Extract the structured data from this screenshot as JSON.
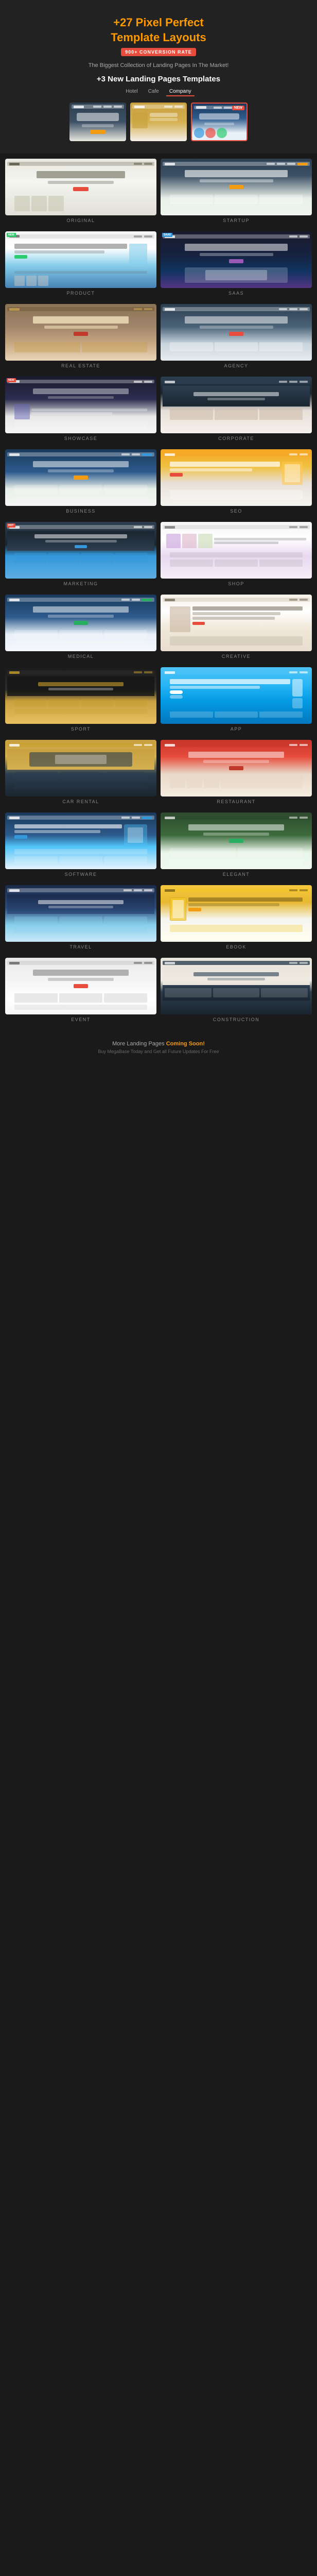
{
  "header": {
    "title_part1": "+27 Pixel Perfect",
    "title_part2": "Template Layouts",
    "badge": "900+ CONVERSION RATE",
    "subtitle": "The Biggest Collection of Landing Pages In The Market!",
    "new_templates_title": "+3 New Landing Pages Templates",
    "tabs": [
      "Hotel",
      "Cafe",
      "Company"
    ],
    "active_tab": "Company"
  },
  "templates": [
    {
      "id": "original",
      "label": "ORIGINAL",
      "style": "tpl-original",
      "tag": null
    },
    {
      "id": "startup",
      "label": "STARTUP",
      "style": "tpl-startup",
      "tag": null
    },
    {
      "id": "product",
      "label": "PRODUCT",
      "style": "tpl-product",
      "tag": "PRODUCT"
    },
    {
      "id": "saas",
      "label": "SAAS",
      "style": "tpl-saas",
      "tag": "SAAS"
    },
    {
      "id": "realestate",
      "label": "REAL ESTATE",
      "style": "tpl-realestate",
      "tag": null
    },
    {
      "id": "agency",
      "label": "AGENCY",
      "style": "tpl-agency",
      "tag": null
    },
    {
      "id": "showcase",
      "label": "SHOWCASE",
      "style": "tpl-showcase",
      "tag": null
    },
    {
      "id": "corporate",
      "label": "CORPORATE",
      "style": "tpl-corporate",
      "tag": null
    },
    {
      "id": "business",
      "label": "BUSINESS",
      "style": "tpl-business",
      "tag": null
    },
    {
      "id": "seo",
      "label": "SEO",
      "style": "tpl-seo",
      "tag": null
    },
    {
      "id": "marketing",
      "label": "MARKETING",
      "style": "tpl-marketing",
      "tag": null
    },
    {
      "id": "shop",
      "label": "SHOP",
      "style": "tpl-shop",
      "tag": null
    },
    {
      "id": "medical",
      "label": "MEDICAL",
      "style": "tpl-medical",
      "tag": null
    },
    {
      "id": "creative",
      "label": "CREATIVE",
      "style": "tpl-creative",
      "tag": null
    },
    {
      "id": "sport",
      "label": "SPORT",
      "style": "tpl-sport",
      "tag": null
    },
    {
      "id": "app",
      "label": "APP",
      "style": "tpl-app",
      "tag": null
    },
    {
      "id": "carrental",
      "label": "CAR RENTAL",
      "style": "tpl-carrental",
      "tag": null
    },
    {
      "id": "restaurant",
      "label": "RESTAURANT",
      "style": "tpl-restaurant",
      "tag": null
    },
    {
      "id": "software",
      "label": "SOFTWARE",
      "style": "tpl-software",
      "tag": null
    },
    {
      "id": "elegant",
      "label": "ELEGANT",
      "style": "tpl-elegant",
      "tag": null
    },
    {
      "id": "travel",
      "label": "TRAVEL",
      "style": "tpl-travel",
      "tag": null
    },
    {
      "id": "ebook",
      "label": "EBOOK",
      "style": "tpl-ebook",
      "tag": null
    },
    {
      "id": "event",
      "label": "EVENT",
      "style": "tpl-event",
      "tag": null
    },
    {
      "id": "construction",
      "label": "CONSTRUCTION",
      "style": "tpl-construction",
      "tag": null
    }
  ],
  "footer": {
    "text1": "More Landing Pages",
    "coming_soon": "Coming Soon!",
    "text2": "Buy MegaBase Today and Get all Future Updates For Free"
  }
}
